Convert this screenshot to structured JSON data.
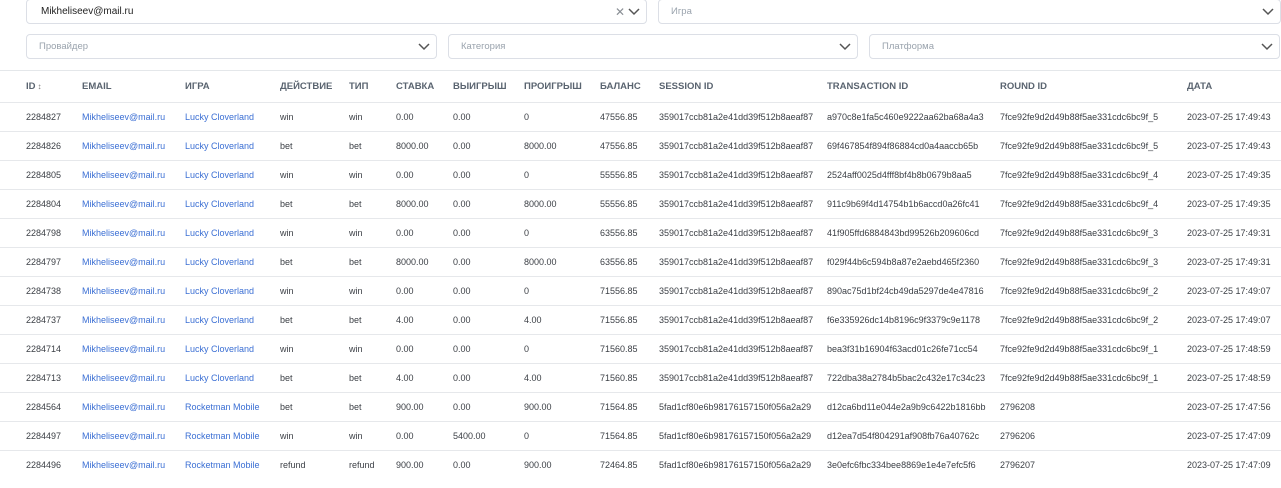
{
  "filters": {
    "user": {
      "value": "Mikheliseev@mail.ru"
    },
    "game": {
      "placeholder": "Игра"
    },
    "provider": {
      "placeholder": "Провайдер"
    },
    "category": {
      "placeholder": "Категория"
    },
    "platform": {
      "placeholder": "Платформа"
    }
  },
  "table": {
    "columns": [
      "ID",
      "EMAIL",
      "ИГРА",
      "ДЕЙСТВИЕ",
      "ТИП",
      "СТАВКА",
      "ВЫИГРЫШ",
      "ПРОИГРЫШ",
      "БАЛАНС",
      "SESSION ID",
      "TRANSACTION ID",
      "ROUND ID",
      "ДАТА"
    ],
    "sort_indicator": "↕",
    "rows": [
      [
        "2284827",
        "Mikheliseev@mail.ru",
        "Lucky Cloverland",
        "win",
        "win",
        "0.00",
        "0.00",
        "0",
        "47556.85",
        "359017ccb81a2e41dd39f512b8aeaf87",
        "a970c8e1fa5c460e9222aa62ba68a4a3",
        "7fce92fe9d2d49b88f5ae331cdc6bc9f_5",
        "2023-07-25 17:49:43"
      ],
      [
        "2284826",
        "Mikheliseev@mail.ru",
        "Lucky Cloverland",
        "bet",
        "bet",
        "8000.00",
        "0.00",
        "8000.00",
        "47556.85",
        "359017ccb81a2e41dd39f512b8aeaf87",
        "69f467854f894f86884cd0a4aaccb65b",
        "7fce92fe9d2d49b88f5ae331cdc6bc9f_5",
        "2023-07-25 17:49:43"
      ],
      [
        "2284805",
        "Mikheliseev@mail.ru",
        "Lucky Cloverland",
        "win",
        "win",
        "0.00",
        "0.00",
        "0",
        "55556.85",
        "359017ccb81a2e41dd39f512b8aeaf87",
        "2524aff0025d4fff8bf4b8b0679b8aa5",
        "7fce92fe9d2d49b88f5ae331cdc6bc9f_4",
        "2023-07-25 17:49:35"
      ],
      [
        "2284804",
        "Mikheliseev@mail.ru",
        "Lucky Cloverland",
        "bet",
        "bet",
        "8000.00",
        "0.00",
        "8000.00",
        "55556.85",
        "359017ccb81a2e41dd39f512b8aeaf87",
        "911c9b69f4d14754b1b6accd0a26fc41",
        "7fce92fe9d2d49b88f5ae331cdc6bc9f_4",
        "2023-07-25 17:49:35"
      ],
      [
        "2284798",
        "Mikheliseev@mail.ru",
        "Lucky Cloverland",
        "win",
        "win",
        "0.00",
        "0.00",
        "0",
        "63556.85",
        "359017ccb81a2e41dd39f512b8aeaf87",
        "41f905ffd6884843bd99526b209606cd",
        "7fce92fe9d2d49b88f5ae331cdc6bc9f_3",
        "2023-07-25 17:49:31"
      ],
      [
        "2284797",
        "Mikheliseev@mail.ru",
        "Lucky Cloverland",
        "bet",
        "bet",
        "8000.00",
        "0.00",
        "8000.00",
        "63556.85",
        "359017ccb81a2e41dd39f512b8aeaf87",
        "f029f44b6c594b8a87e2aebd465f2360",
        "7fce92fe9d2d49b88f5ae331cdc6bc9f_3",
        "2023-07-25 17:49:31"
      ],
      [
        "2284738",
        "Mikheliseev@mail.ru",
        "Lucky Cloverland",
        "win",
        "win",
        "0.00",
        "0.00",
        "0",
        "71556.85",
        "359017ccb81a2e41dd39f512b8aeaf87",
        "890ac75d1bf24cb49da5297de4e47816",
        "7fce92fe9d2d49b88f5ae331cdc6bc9f_2",
        "2023-07-25 17:49:07"
      ],
      [
        "2284737",
        "Mikheliseev@mail.ru",
        "Lucky Cloverland",
        "bet",
        "bet",
        "4.00",
        "0.00",
        "4.00",
        "71556.85",
        "359017ccb81a2e41dd39f512b8aeaf87",
        "f6e335926dc14b8196c9f3379c9e1178",
        "7fce92fe9d2d49b88f5ae331cdc6bc9f_2",
        "2023-07-25 17:49:07"
      ],
      [
        "2284714",
        "Mikheliseev@mail.ru",
        "Lucky Cloverland",
        "win",
        "win",
        "0.00",
        "0.00",
        "0",
        "71560.85",
        "359017ccb81a2e41dd39f512b8aeaf87",
        "bea3f31b16904f63acd01c26fe71cc54",
        "7fce92fe9d2d49b88f5ae331cdc6bc9f_1",
        "2023-07-25 17:48:59"
      ],
      [
        "2284713",
        "Mikheliseev@mail.ru",
        "Lucky Cloverland",
        "bet",
        "bet",
        "4.00",
        "0.00",
        "4.00",
        "71560.85",
        "359017ccb81a2e41dd39f512b8aeaf87",
        "722dba38a2784b5bac2c432e17c34c23",
        "7fce92fe9d2d49b88f5ae331cdc6bc9f_1",
        "2023-07-25 17:48:59"
      ],
      [
        "2284564",
        "Mikheliseev@mail.ru",
        "Rocketman Mobile",
        "bet",
        "bet",
        "900.00",
        "0.00",
        "900.00",
        "71564.85",
        "5fad1cf80e6b98176157150f056a2a29",
        "d12ca6bd11e044e2a9b9c6422b1816bb",
        "2796208",
        "2023-07-25 17:47:56"
      ],
      [
        "2284497",
        "Mikheliseev@mail.ru",
        "Rocketman Mobile",
        "win",
        "win",
        "0.00",
        "5400.00",
        "0",
        "71564.85",
        "5fad1cf80e6b98176157150f056a2a29",
        "d12ea7d54f804291af908fb76a40762c",
        "2796206",
        "2023-07-25 17:47:09"
      ],
      [
        "2284496",
        "Mikheliseev@mail.ru",
        "Rocketman Mobile",
        "refund",
        "refund",
        "900.00",
        "0.00",
        "900.00",
        "72464.85",
        "5fad1cf80e6b98176157150f056a2a29",
        "3e0efc6fbc334bee8869e1e4e7efc5f6",
        "2796207",
        "2023-07-25 17:47:09"
      ]
    ]
  }
}
